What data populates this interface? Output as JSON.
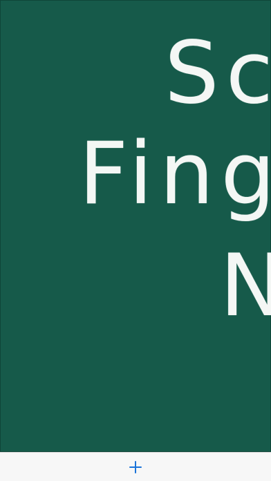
{
  "board": {
    "background_color": "#165a4a",
    "lines": [
      "Sc",
      "Fing",
      "N"
    ]
  },
  "toolbar": {
    "background_color": "#f7f7f7",
    "add_icon": "plus-icon",
    "accent_color": "#1a73d9"
  }
}
